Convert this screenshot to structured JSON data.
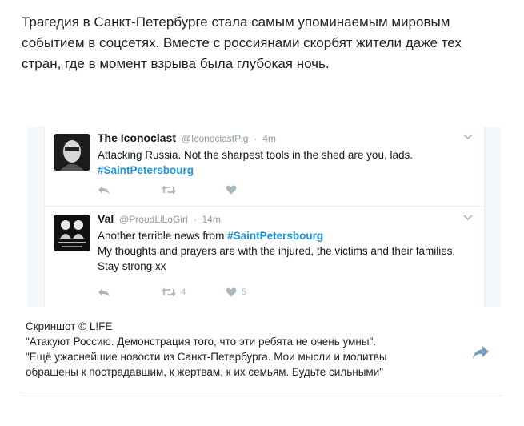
{
  "post": {
    "text": "Трагедия в Санкт-Петербурге стала самым упоминаемым мировым событием в соцсетях. Вместе с россиянами скорбят жители даже тех стран, где в момент взрыва была глубокая ночь."
  },
  "tweets": [
    {
      "name": "The Iconoclast",
      "handle": "@IconoclastPig",
      "sep": "·",
      "time": "4m",
      "text": "Attacking Russia. Not the sharpest tools in the shed are you, lads.",
      "hashtag": "#SaintPetersbourg",
      "retweets": "",
      "likes": ""
    },
    {
      "name": "Val",
      "handle": "@ProudLiLoGirl",
      "sep": "·",
      "time": "14m",
      "text_before": "Another terrible news from ",
      "hashtag": "#SaintPetersbourg",
      "text_after": "My thoughts and prayers are with the injured, the victims and their families. Stay strong xx",
      "retweets": "4",
      "likes": "5"
    }
  ],
  "caption": {
    "line1": "Скриншот © L!FE",
    "line2": "\"Атакуют Россию. Демонстрация того, что эти ребята не очень умны\".",
    "line3": "\"Ещё ужаснейшие новости из Санкт-Петербурга. Мои мысли и молитвы",
    "line4": "обращены к пострадавшим, к жертвам, к их семьям. Будьте сильными\""
  },
  "colors": {
    "hashtag": "#1b95e0",
    "action_icons": "#aab8c2",
    "share_icon": "#7a9cc6"
  },
  "icons": [
    "reply-icon",
    "retweet-icon",
    "like-icon",
    "caret-down-icon",
    "share-arrow-icon"
  ]
}
